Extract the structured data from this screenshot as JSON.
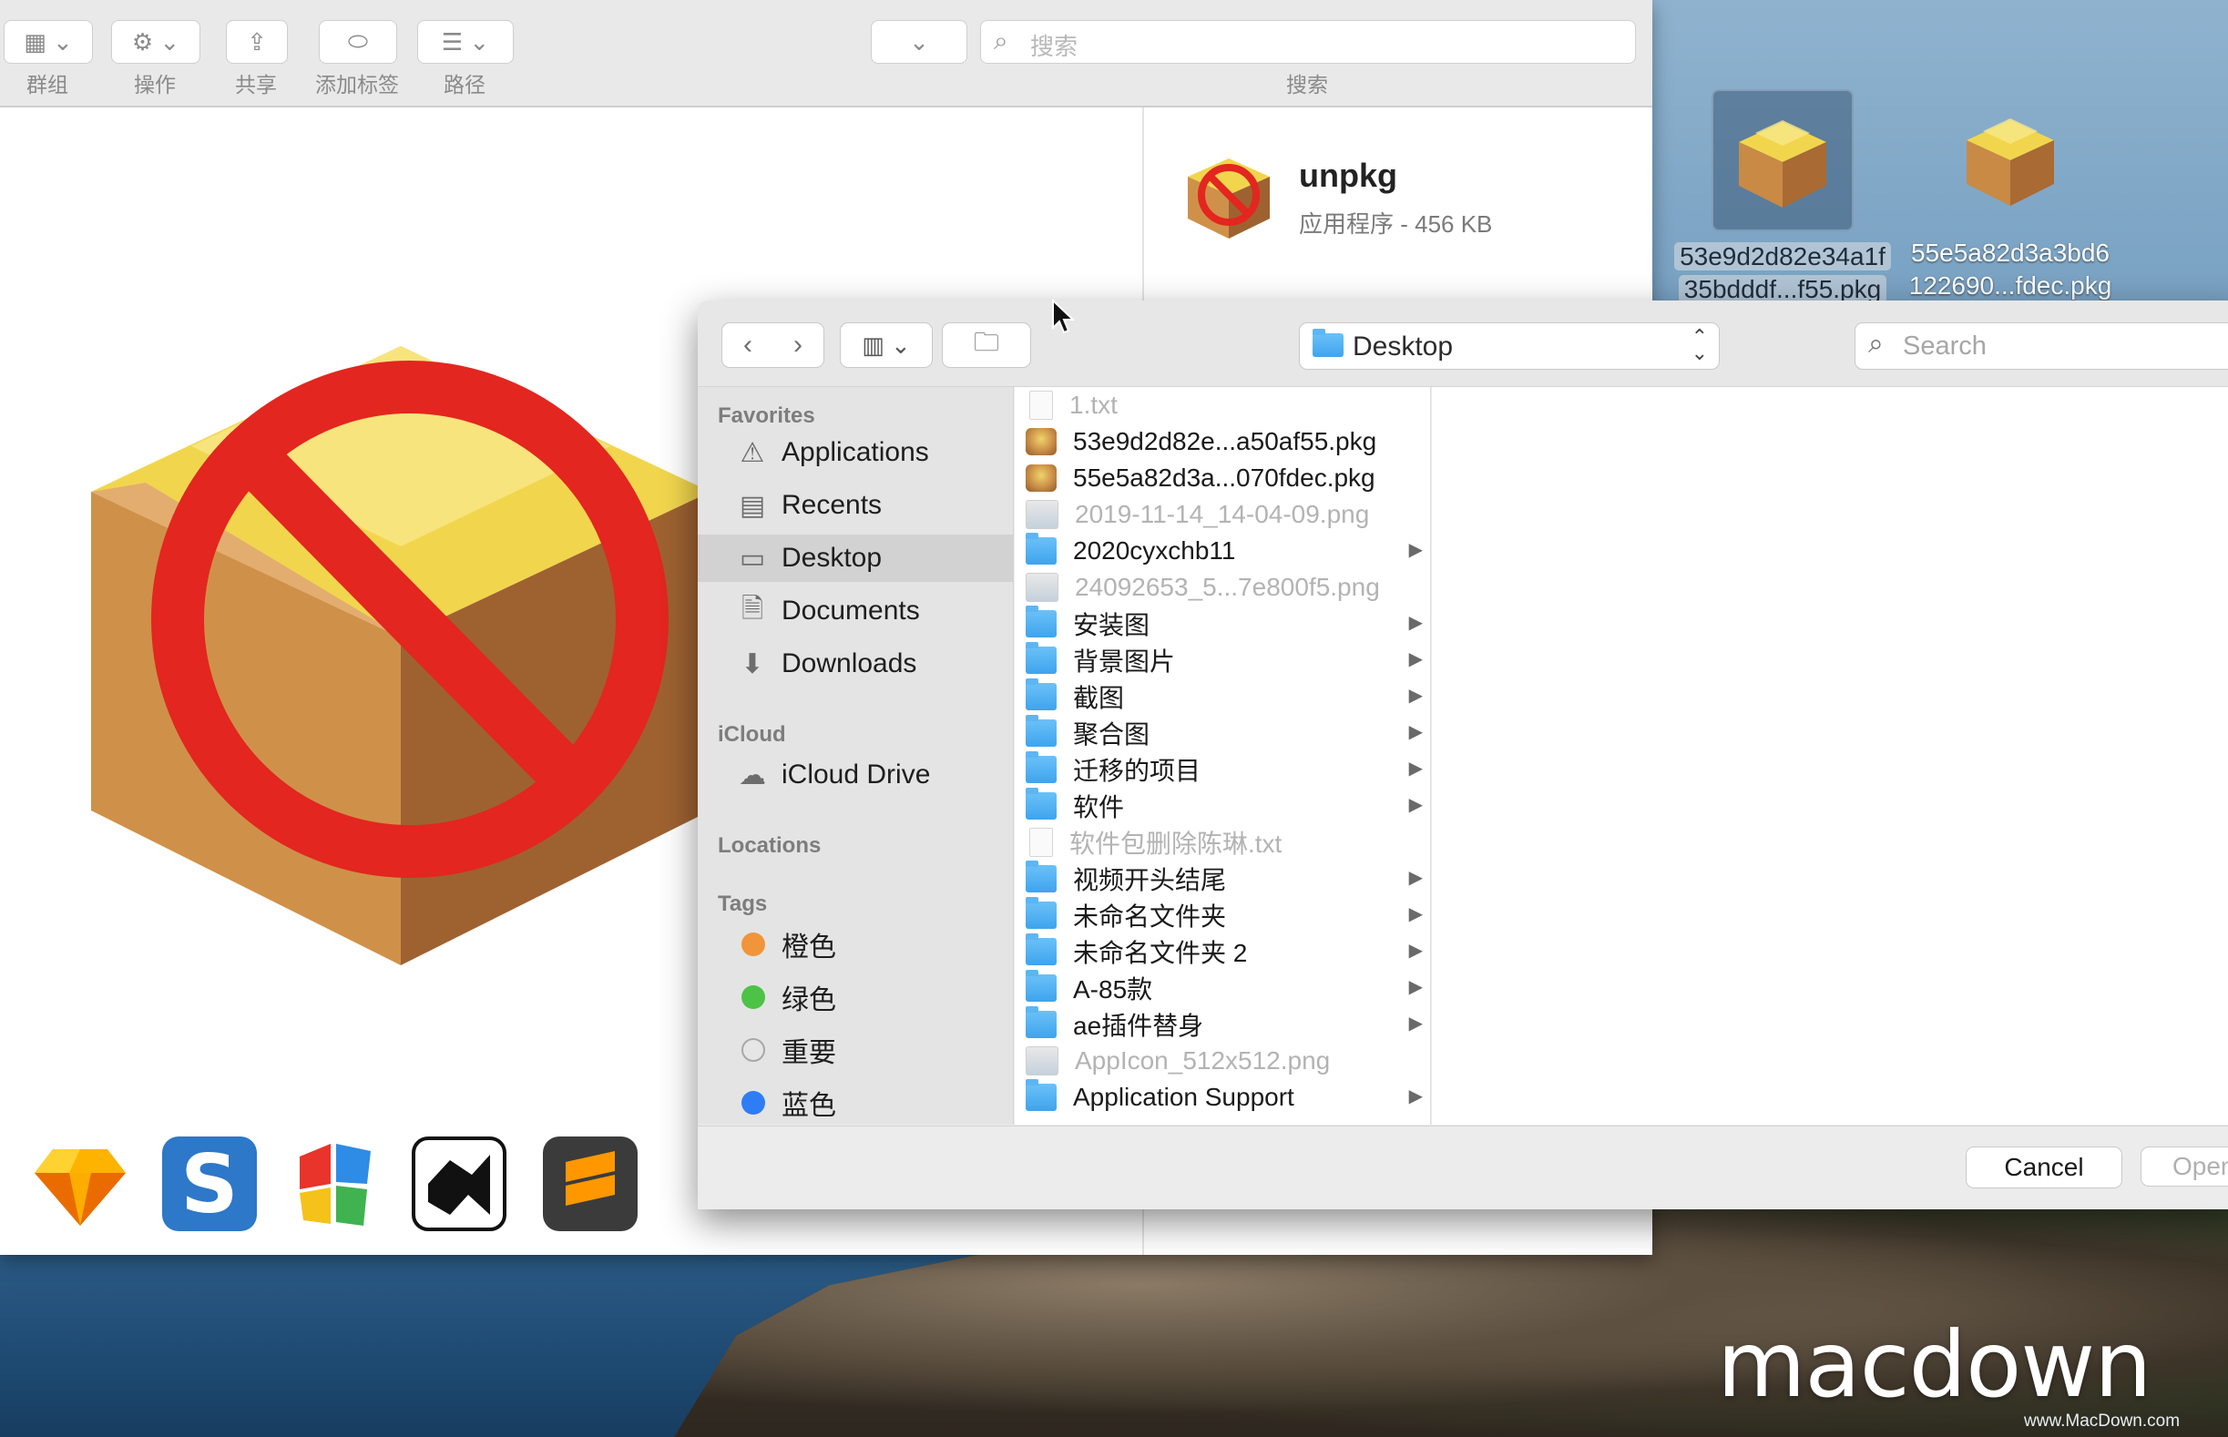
{
  "finder_window": {
    "toolbar": {
      "group_label": "群组",
      "action_label": "操作",
      "share_label": "共享",
      "add_tag_label": "添加标签",
      "path_label": "路径",
      "search_label": "搜索",
      "search_placeholder": "搜索"
    },
    "info": {
      "app_name": "unpkg",
      "app_meta": "应用程序 - 456 KB"
    }
  },
  "desktop": {
    "icons": [
      {
        "line1": "53e9d2d82e34a1f",
        "line2": "35bdddf...f55.pkg",
        "selected": true
      },
      {
        "line1": "55e5a82d3a3bd6",
        "line2": "122690...fdec.pkg",
        "selected": false
      }
    ],
    "watermark": "macdown",
    "watermark_url": "www.MacDown.com"
  },
  "open_dialog": {
    "location": "Desktop",
    "search_placeholder": "Search",
    "sidebar": {
      "favorites_header": "Favorites",
      "favorites": [
        {
          "label": "Applications",
          "icon": "applications-icon"
        },
        {
          "label": "Recents",
          "icon": "recents-icon"
        },
        {
          "label": "Desktop",
          "icon": "desktop-icon",
          "selected": true
        },
        {
          "label": "Documents",
          "icon": "documents-icon"
        },
        {
          "label": "Downloads",
          "icon": "downloads-icon"
        }
      ],
      "icloud_header": "iCloud",
      "icloud": [
        {
          "label": "iCloud Drive",
          "icon": "cloud-icon"
        }
      ],
      "locations_header": "Locations",
      "tags_header": "Tags",
      "tags": [
        {
          "label": "橙色",
          "color": "#f0953a"
        },
        {
          "label": "绿色",
          "color": "#4cc347"
        },
        {
          "label": "重要",
          "color": "#e6e6e6"
        },
        {
          "label": "蓝色",
          "color": "#2f7df6"
        }
      ]
    },
    "files": [
      {
        "name": "1.txt",
        "kind": "doc",
        "enabled": false,
        "folder": false
      },
      {
        "name": "53e9d2d82e...a50af55.pkg",
        "kind": "pkg",
        "enabled": true,
        "folder": false
      },
      {
        "name": "55e5a82d3a...070fdec.pkg",
        "kind": "pkg",
        "enabled": true,
        "folder": false
      },
      {
        "name": "2019-11-14_14-04-09.png",
        "kind": "img",
        "enabled": false,
        "folder": false
      },
      {
        "name": "2020cyxchb11",
        "kind": "folder",
        "enabled": true,
        "folder": true
      },
      {
        "name": "24092653_5...7e800f5.png",
        "kind": "img",
        "enabled": false,
        "folder": false
      },
      {
        "name": "安装图",
        "kind": "folder",
        "enabled": true,
        "folder": true
      },
      {
        "name": "背景图片",
        "kind": "folder",
        "enabled": true,
        "folder": true
      },
      {
        "name": "截图",
        "kind": "folder",
        "enabled": true,
        "folder": true
      },
      {
        "name": "聚合图",
        "kind": "folder",
        "enabled": true,
        "folder": true
      },
      {
        "name": "迁移的项目",
        "kind": "folder",
        "enabled": true,
        "folder": true
      },
      {
        "name": "软件",
        "kind": "folder",
        "enabled": true,
        "folder": true
      },
      {
        "name": "软件包删除陈琳.txt",
        "kind": "doc",
        "enabled": false,
        "folder": false
      },
      {
        "name": "视频开头结尾",
        "kind": "folder",
        "enabled": true,
        "folder": true
      },
      {
        "name": "未命名文件夹",
        "kind": "folder",
        "enabled": true,
        "folder": true
      },
      {
        "name": "未命名文件夹 2",
        "kind": "folder",
        "enabled": true,
        "folder": true
      },
      {
        "name": "A-85款",
        "kind": "folder",
        "enabled": true,
        "folder": true
      },
      {
        "name": "ae插件替身",
        "kind": "folder",
        "enabled": true,
        "folder": true
      },
      {
        "name": "AppIcon_512x512.png",
        "kind": "img",
        "enabled": false,
        "folder": false
      },
      {
        "name": "Application Support",
        "kind": "folder",
        "enabled": true,
        "folder": true
      }
    ],
    "buttons": {
      "cancel": "Cancel",
      "open": "Open"
    }
  }
}
